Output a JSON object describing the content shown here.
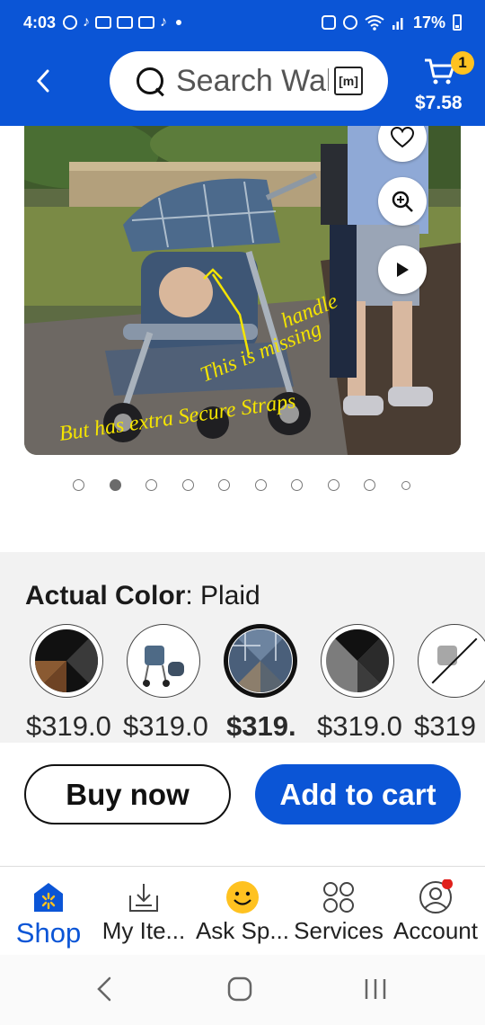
{
  "status_bar": {
    "time": "4:03",
    "battery": "17%"
  },
  "header": {
    "search_placeholder": "Search Walmart",
    "cart_count": "1",
    "cart_total": "$7.58",
    "scan_label": "[m]"
  },
  "product_image": {
    "annotation_handle": "handle",
    "annotation_missing": "This is missing",
    "annotation_straps": "But has extra Secure Straps"
  },
  "carousel": {
    "dot_count": 10,
    "active_index": 1
  },
  "variant": {
    "label": "Actual Color",
    "separator": ": ",
    "value": "Plaid",
    "options": [
      {
        "price": "$319.0",
        "selected": false
      },
      {
        "price": "$319.0",
        "selected": false
      },
      {
        "price": "$319.",
        "selected": true
      },
      {
        "price": "$319.0",
        "selected": false
      },
      {
        "price": "$319",
        "selected": false
      }
    ]
  },
  "actions": {
    "buy_now": "Buy now",
    "add_to_cart": "Add to cart"
  },
  "tabs": [
    {
      "label": "Shop",
      "icon": "shop-icon",
      "active": true
    },
    {
      "label": "My Ite...",
      "icon": "my-items-icon",
      "active": false
    },
    {
      "label": "Ask Sp...",
      "icon": "ask-sparky-icon",
      "active": false
    },
    {
      "label": "Services",
      "icon": "services-icon",
      "active": false
    },
    {
      "label": "Account",
      "icon": "account-icon",
      "active": false
    }
  ],
  "colors": {
    "brand_blue": "#0b55d6",
    "badge_yellow": "#ffc220",
    "annotation_yellow": "#f4e400",
    "notification_red": "#e0201b"
  }
}
